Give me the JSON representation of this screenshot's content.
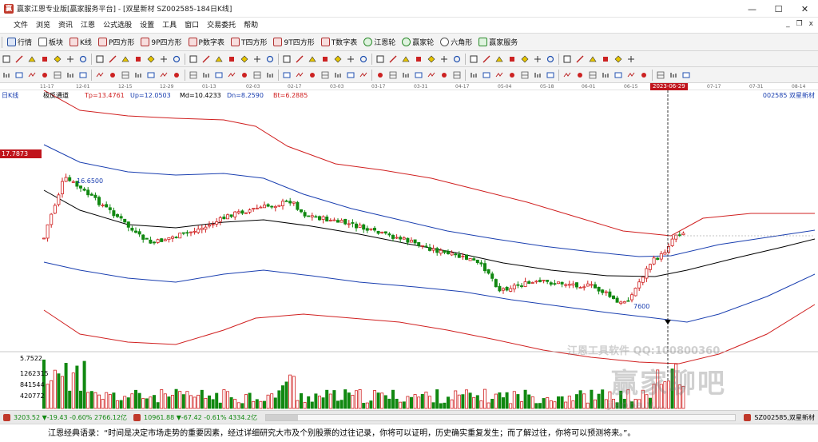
{
  "window": {
    "title": "赢家江恩专业版[赢家服务平台] - [双星新材  SZ002585-184日K线]",
    "buttons": [
      "—",
      "☐",
      "✕"
    ]
  },
  "menu": [
    "文件",
    "浏览",
    "资讯",
    "江恩",
    "公式选股",
    "设置",
    "工具",
    "窗口",
    "交易委托",
    "帮助"
  ],
  "mdi_controls": [
    "_",
    "❐",
    "x"
  ],
  "toolbar1": [
    {
      "label": "行情",
      "icon": "grid-icon"
    },
    {
      "label": "板块",
      "icon": "blocks-icon"
    },
    {
      "label": "K线",
      "icon": "kline-icon"
    },
    {
      "label": "P四方形",
      "icon": "square-p-icon"
    },
    {
      "label": "9P四方形",
      "icon": "square-9p-icon"
    },
    {
      "label": "P数字表",
      "icon": "table-p-icon"
    },
    {
      "label": "T四方形",
      "icon": "square-t-icon"
    },
    {
      "label": "9T四方形",
      "icon": "square-9t-icon"
    },
    {
      "label": "T数字表",
      "icon": "table-t-icon"
    },
    {
      "label": "江恩轮",
      "icon": "gann-wheel-icon"
    },
    {
      "label": "赢家轮",
      "icon": "winner-wheel-icon"
    },
    {
      "label": "六角形",
      "icon": "hexagon-icon"
    },
    {
      "label": "赢家服务",
      "icon": "service-icon"
    }
  ],
  "date_ruler": {
    "ticks": [
      "11-17",
      "12-01",
      "12-15",
      "12-29",
      "01-13",
      "02-03",
      "02-17",
      "03-03",
      "03-17",
      "03-31",
      "04-17",
      "05-04",
      "05-18",
      "06-01",
      "06-15",
      "07-17",
      "07-31",
      "08-14"
    ],
    "selected": "2023-06-29"
  },
  "indicator": {
    "period": "日K线",
    "name": "极反通道",
    "tp": "Tp=13.4761",
    "up": "Up=12.0503",
    "md": "Md=10.4233",
    "dn": "Dn=8.2590",
    "bt": "Bt=6.2885"
  },
  "stock_label": "002585  双星新材",
  "price_tag": "17.7873",
  "high_note": "16.6500",
  "low_note": "7600",
  "volume_axis": [
    "5.7522",
    "1262315",
    "841544",
    "420772"
  ],
  "watermark": {
    "brand": "江恩工具软件    QQ:100800360",
    "big": "赢家聊吧",
    "sub": "jiaoba.v..."
  },
  "statusbar": {
    "sh_index": "3203.52 ▼-19.43 -0.60% 2766.12亿",
    "sz_index": "10961.88 ▼-67.42 -0.61% 4334.2亿",
    "right": "SZ002585,双星新材"
  },
  "quote": "江恩经典语录：“时间是决定市场走势的重要因素，经过详细研究大市及个别股票的过往记录，你将可以证明，历史确实重复发生；而了解过往，你将可以预测将来。”。",
  "colors": {
    "up_candle": "#d02020",
    "down_candle": "#118811",
    "outer_band": "#d02020",
    "inner_band": "#1a3fb0",
    "mid_line": "#000000",
    "accent": "#c0141c"
  },
  "chart_data": {
    "type": "candlestick",
    "title": "双星新材 SZ002585 日K线",
    "bands": {
      "series": [
        {
          "name": "Tp",
          "color": "#d02020"
        },
        {
          "name": "Up",
          "color": "#1a3fb0"
        },
        {
          "name": "Md",
          "color": "#000000"
        },
        {
          "name": "Dn",
          "color": "#1a3fb0"
        },
        {
          "name": "Bt",
          "color": "#d02020"
        }
      ]
    },
    "labels": {
      "high": "16.6500",
      "price_tag": "17.7873"
    }
  }
}
